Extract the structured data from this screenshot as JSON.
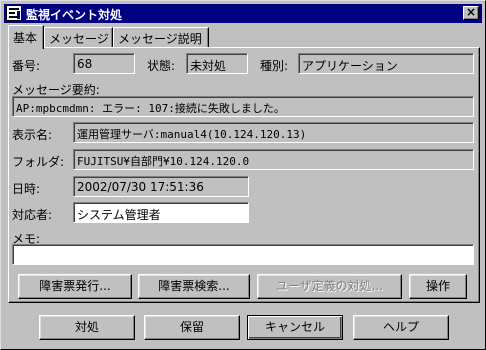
{
  "window": {
    "title": "監視イベント対処",
    "close_glyph": "×"
  },
  "tabs": [
    {
      "label": "基本",
      "active": true
    },
    {
      "label": "メッセージ",
      "active": false
    },
    {
      "label": "メッセージ説明",
      "active": false
    }
  ],
  "fields": {
    "number": {
      "label": "番号:",
      "value": "68"
    },
    "status": {
      "label": "状態:",
      "value": "未対処"
    },
    "kind": {
      "label": "種別:",
      "value": "アプリケーション"
    },
    "summary": {
      "label": "メッセージ要約:",
      "value": "AP:mpbcmdmn: エラー: 107:接続に失敗しました。"
    },
    "display_name": {
      "label": "表示名:",
      "value": "運用管理サーバ:manual4(10.124.120.13)"
    },
    "folder": {
      "label": "フォルダ:",
      "value": "FUJITSU¥自部門¥10.124.120.0"
    },
    "datetime": {
      "label": "日時:",
      "value": "2002/07/30 17:51:36"
    },
    "handler": {
      "label": "対応者:",
      "value": "システム管理者"
    },
    "memo": {
      "label": "メモ:",
      "value": ""
    }
  },
  "panel_buttons": {
    "issue_ticket": "障害票発行...",
    "search_ticket": "障害票検索...",
    "user_action": "ユーザ定義の対処...",
    "operation": "操作"
  },
  "dialog_buttons": {
    "handle": "対処",
    "hold": "保留",
    "cancel": "キャンセル",
    "help": "ヘルプ"
  }
}
